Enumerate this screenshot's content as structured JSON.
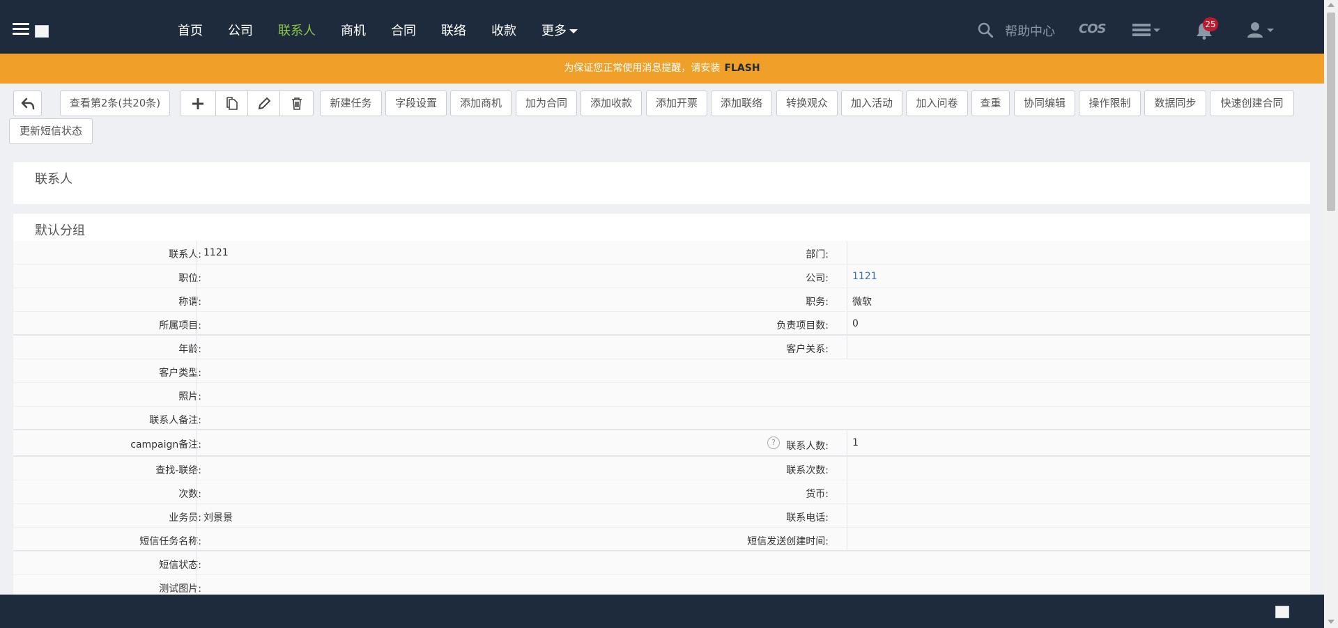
{
  "nav": {
    "items": [
      {
        "label": "首页",
        "active": false
      },
      {
        "label": "公司",
        "active": false
      },
      {
        "label": "联系人",
        "active": true
      },
      {
        "label": "商机",
        "active": false
      },
      {
        "label": "合同",
        "active": false
      },
      {
        "label": "联络",
        "active": false
      },
      {
        "label": "收款",
        "active": false
      },
      {
        "label": "更多",
        "active": false
      }
    ],
    "help": "帮助中心",
    "cos": "COS",
    "notification_count": "25",
    "active_color": "#8bc34a",
    "bg_color": "#1e2b3c"
  },
  "banner": {
    "text": "为保证您正常使用消息提醒，请安装",
    "flash": "FLASH",
    "color": "#f0a028"
  },
  "toolbar": {
    "view_record": "查看第2条(共20条)",
    "buttons": [
      "新建任务",
      "字段设置",
      "添加商机",
      "加为合同",
      "添加收款",
      "添加开票",
      "添加联络",
      "转换观众",
      "加入活动",
      "加入问卷",
      "查重",
      "协同编辑",
      "操作限制",
      "数据同步",
      "快速创建合同"
    ],
    "second_row": "更新短信状态"
  },
  "sections": {
    "header_title": "联系人",
    "group_title": "默认分组"
  },
  "fields": {
    "r1": {
      "l1": "联系人:",
      "v1": "1121",
      "l2": "部门:",
      "v2": ""
    },
    "r2": {
      "l1": "职位:",
      "v1": "",
      "l2": "公司:",
      "v2": "1121"
    },
    "r3": {
      "l1": "称谓:",
      "v1": "",
      "l2": "职务:",
      "v2": "微软"
    },
    "r4": {
      "l1": "所属项目:",
      "v1": "",
      "l2": "负责项目数:",
      "v2": "0"
    },
    "r5": {
      "l1": "年龄:",
      "v1": "",
      "l2": "客户关系:",
      "v2": ""
    },
    "r6": {
      "l1": "客户类型:",
      "v1": ""
    },
    "r7": {
      "l1": "照片:",
      "v1": ""
    },
    "r8": {
      "l1": "联系人备注:",
      "v1": ""
    },
    "r9": {
      "l1": "campaign备注:",
      "v1": "",
      "help": "?",
      "l2": "联系人数:",
      "v2": "1"
    },
    "r10": {
      "l1": "查找-联络:",
      "v1": "",
      "l2": "联系次数:",
      "v2": ""
    },
    "r11": {
      "l1": "次数:",
      "v1": "",
      "l2": "货币:",
      "v2": ""
    },
    "r12": {
      "l1": "业务员:",
      "v1": "刘景景",
      "l2": "联系电话:",
      "v2": ""
    },
    "r13": {
      "l1": "短信任务名称:",
      "v1": "",
      "l2": "短信发送创建时间:",
      "v2": ""
    },
    "r14": {
      "l1": "短信状态:",
      "v1": ""
    },
    "r15": {
      "l1": "测试图片:",
      "v1": ""
    }
  }
}
